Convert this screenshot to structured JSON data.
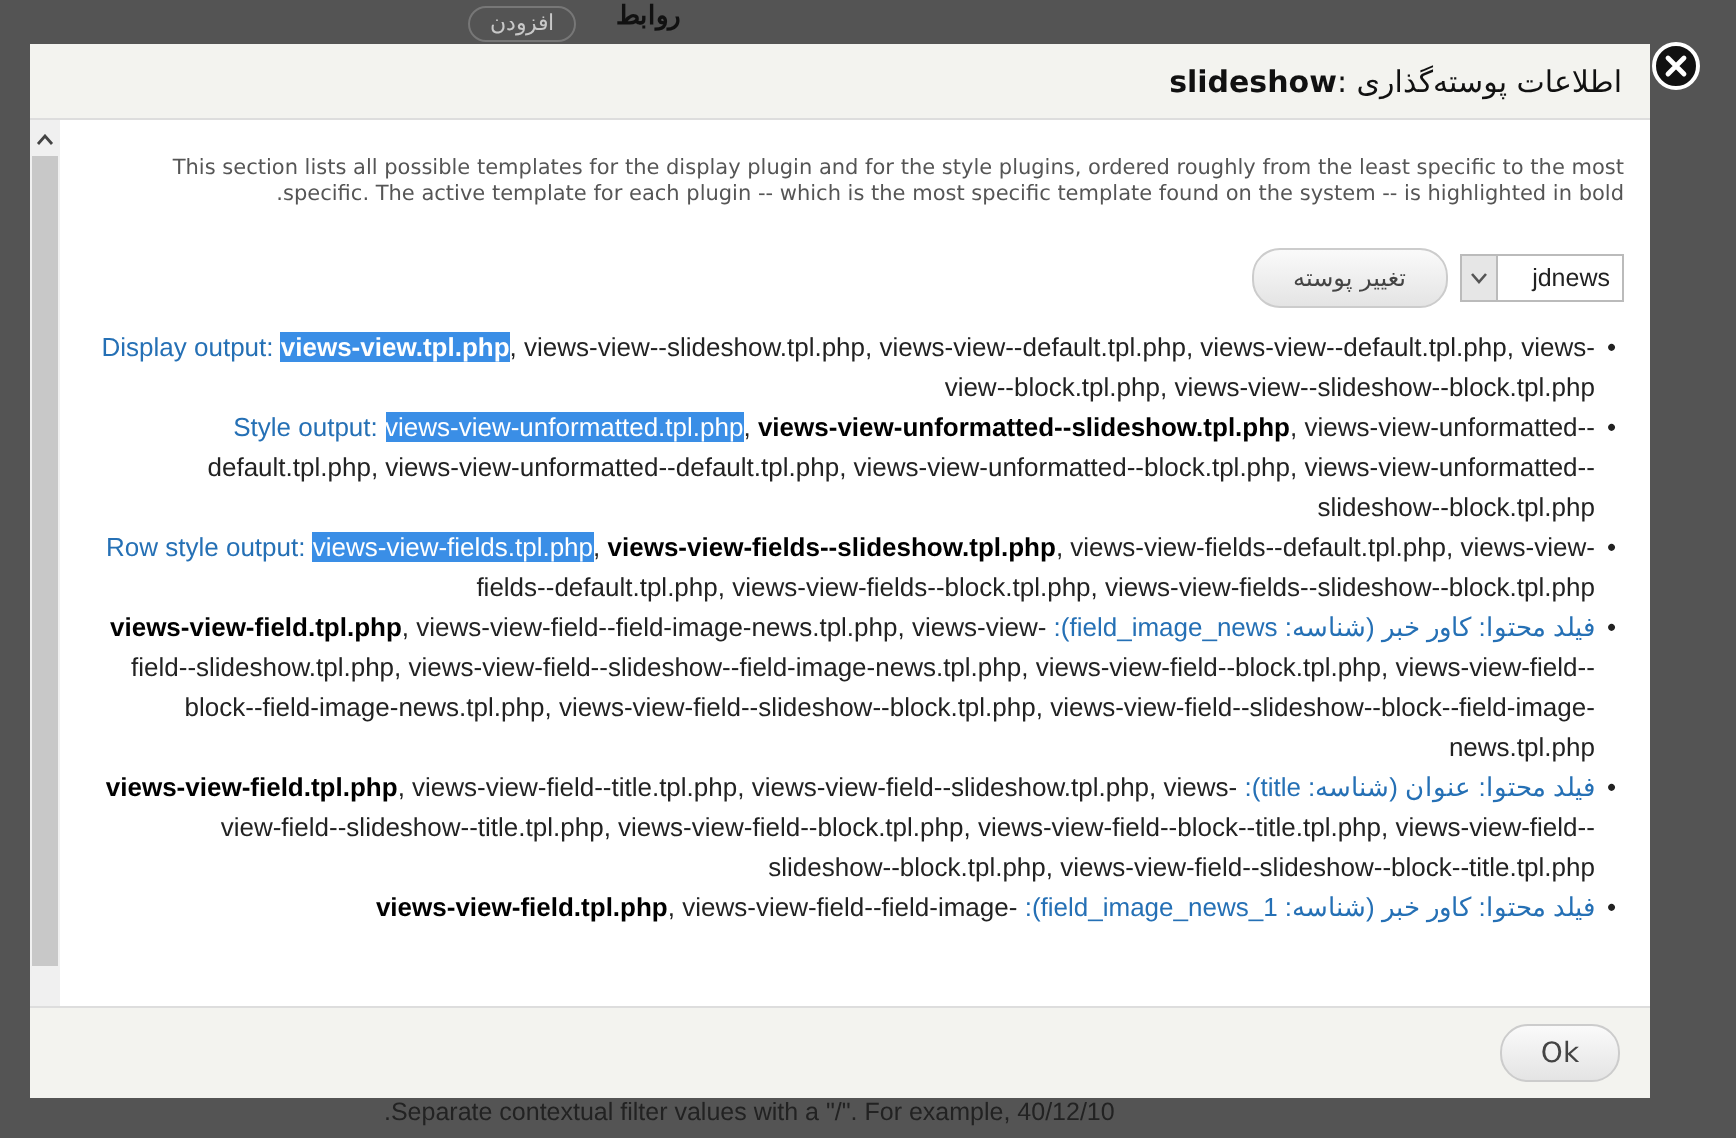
{
  "background": {
    "top_label": "روابط",
    "top_button": "افزودن",
    "bottom_text": ".Separate contextual filter values with a \"/\". For example, 40/12/10"
  },
  "dialog": {
    "title_en": "slideshow",
    "title_fa": ": اطلاعات پوسته‌گذاری",
    "description": "This section lists all possible templates for the display plugin and for the style plugins, ordered roughly from the least specific to the most specific. The active template for each plugin -- which is the most specific template found on the system -- is highlighted in bold.",
    "theme_select": {
      "value": "jdnews"
    },
    "change_button": "تغییر پوسته",
    "separator": ",",
    "bullet": "•",
    "items": [
      {
        "label": "Display output:",
        "templates": [
          {
            "name": "views-view.tpl.php",
            "bold": true,
            "highlighted": true
          },
          {
            "name": "views-view--slideshow.tpl.php",
            "bold": false,
            "highlighted": false
          },
          {
            "name": "views-view--default.tpl.php",
            "bold": false,
            "highlighted": false
          },
          {
            "name": "views-view--default.tpl.php",
            "bold": false,
            "highlighted": false
          },
          {
            "name": "views-view--block.tpl.php",
            "bold": false,
            "highlighted": false
          },
          {
            "name": "views-view--slideshow--block.tpl.php",
            "bold": false,
            "highlighted": false
          }
        ]
      },
      {
        "label": "Style output:",
        "templates": [
          {
            "name": "views-view-unformatted.tpl.php",
            "bold": false,
            "highlighted": true
          },
          {
            "name": "views-view-unformatted--slideshow.tpl.php",
            "bold": true,
            "highlighted": false
          },
          {
            "name": "views-view-unformatted--default.tpl.php",
            "bold": false,
            "highlighted": false
          },
          {
            "name": "views-view-unformatted--default.tpl.php",
            "bold": false,
            "highlighted": false
          },
          {
            "name": "views-view-unformatted--block.tpl.php",
            "bold": false,
            "highlighted": false
          },
          {
            "name": "views-view-unformatted--slideshow--block.tpl.php",
            "bold": false,
            "highlighted": false
          }
        ]
      },
      {
        "label": "Row style output:",
        "templates": [
          {
            "name": "views-view-fields.tpl.php",
            "bold": false,
            "highlighted": true
          },
          {
            "name": "views-view-fields--slideshow.tpl.php",
            "bold": true,
            "highlighted": false
          },
          {
            "name": "views-view-fields--default.tpl.php",
            "bold": false,
            "highlighted": false
          },
          {
            "name": "views-view-fields--default.tpl.php",
            "bold": false,
            "highlighted": false
          },
          {
            "name": "views-view-fields--block.tpl.php",
            "bold": false,
            "highlighted": false
          },
          {
            "name": "views-view-fields--slideshow--block.tpl.php",
            "bold": false,
            "highlighted": false
          }
        ]
      },
      {
        "label": "فیلد محتوا: کاور خبر (شناسه: field_image_news):",
        "templates": [
          {
            "name": "views-view-field.tpl.php",
            "bold": true,
            "highlighted": false
          },
          {
            "name": "views-view-field--field-image-news.tpl.php",
            "bold": false,
            "highlighted": false
          },
          {
            "name": "views-view-field--slideshow.tpl.php",
            "bold": false,
            "highlighted": false
          },
          {
            "name": "views-view-field--slideshow--field-image-news.tpl.php",
            "bold": false,
            "highlighted": false
          },
          {
            "name": "views-view-field--block.tpl.php",
            "bold": false,
            "highlighted": false
          },
          {
            "name": "views-view-field--block--field-image-news.tpl.php",
            "bold": false,
            "highlighted": false
          },
          {
            "name": "views-view-field--slideshow--block.tpl.php",
            "bold": false,
            "highlighted": false
          },
          {
            "name": "views-view-field--slideshow--block--field-image-news.tpl.php",
            "bold": false,
            "highlighted": false
          }
        ]
      },
      {
        "label": "فیلد محتوا: عنوان (شناسه: title):",
        "templates": [
          {
            "name": "views-view-field.tpl.php",
            "bold": true,
            "highlighted": false
          },
          {
            "name": "views-view-field--title.tpl.php",
            "bold": false,
            "highlighted": false
          },
          {
            "name": "views-view-field--slideshow.tpl.php",
            "bold": false,
            "highlighted": false
          },
          {
            "name": "views-view-field--slideshow--title.tpl.php",
            "bold": false,
            "highlighted": false
          },
          {
            "name": "views-view-field--block.tpl.php",
            "bold": false,
            "highlighted": false
          },
          {
            "name": "views-view-field--block--title.tpl.php",
            "bold": false,
            "highlighted": false
          },
          {
            "name": "views-view-field--slideshow--block.tpl.php",
            "bold": false,
            "highlighted": false
          },
          {
            "name": "views-view-field--slideshow--block--title.tpl.php",
            "bold": false,
            "highlighted": false
          }
        ]
      },
      {
        "label": "فیلد محتوا: کاور خبر (شناسه: field_image_news_1):",
        "templates": [
          {
            "name": "views-view-field.tpl.php",
            "bold": true,
            "highlighted": false
          },
          {
            "name": "views-view-field--field-image-",
            "bold": false,
            "highlighted": false
          }
        ]
      }
    ],
    "ok_button": "Ok"
  }
}
